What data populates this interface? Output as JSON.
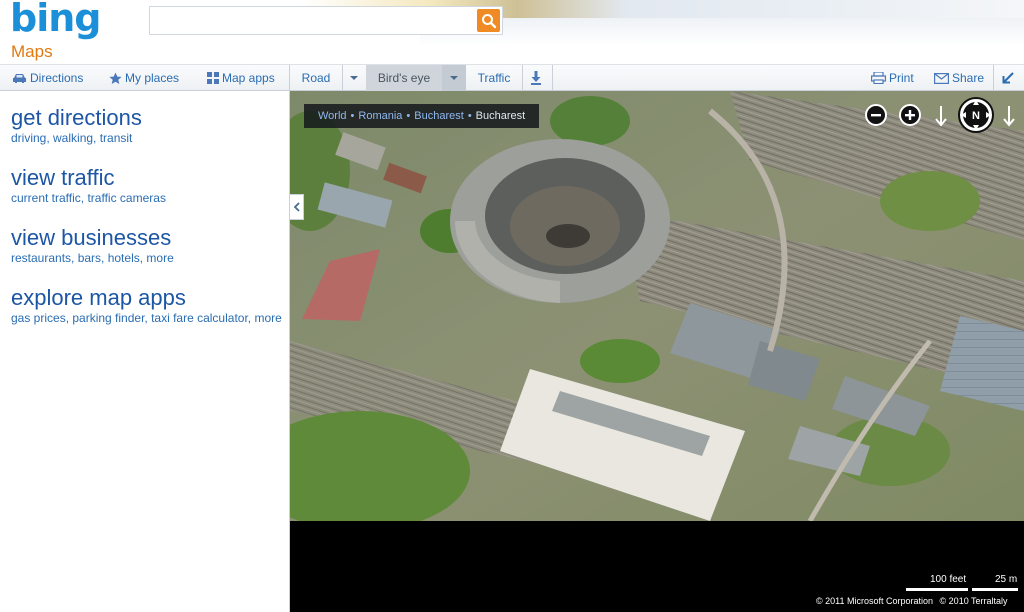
{
  "header": {
    "logo": "bing",
    "product": "Maps",
    "search": {
      "value": "",
      "placeholder": ""
    }
  },
  "toolbar": {
    "directions_label": "Directions",
    "my_places_label": "My places",
    "map_apps_label": "Map apps",
    "road_label": "Road",
    "birds_eye_label": "Bird's eye",
    "traffic_label": "Traffic",
    "print_label": "Print",
    "share_label": "Share"
  },
  "sidebar": {
    "items": [
      {
        "title": "get directions",
        "subtitle": "driving, walking, transit"
      },
      {
        "title": "view traffic",
        "subtitle": "current traffic, traffic cameras"
      },
      {
        "title": "view businesses",
        "subtitle": "restaurants, bars, hotels, more"
      },
      {
        "title": "explore map apps",
        "subtitle": "gas prices, parking finder, taxi fare calculator, more"
      }
    ]
  },
  "map": {
    "breadcrumb": [
      "World",
      "Romania",
      "Bucharest",
      "Bucharest"
    ],
    "compass_label": "N",
    "scale_feet": "100 feet",
    "scale_meters": "25 m",
    "copyright_ms": "© 2011 Microsoft Corporation",
    "copyright_tl": "© 2010 Terraltaly"
  },
  "colors": {
    "brand_blue": "#1b8fd8",
    "maps_orange": "#e07a10",
    "link_blue": "#2a6db3",
    "search_orange": "#f08a24"
  },
  "icons": {
    "search": "magnifier-icon",
    "directions": "car-icon",
    "my_places": "star-icon",
    "map_apps": "grid-icon",
    "traffic_download": "download-arrow-icon",
    "print": "printer-icon",
    "share": "envelope-icon",
    "collapse": "chevron-left-icon",
    "zoom_out": "minus-circle-icon",
    "zoom_in": "plus-circle-icon",
    "rotate_left": "rotate-left-arrow-icon",
    "compass": "compass-icon",
    "rotate_right": "rotate-right-arrow-icon"
  }
}
